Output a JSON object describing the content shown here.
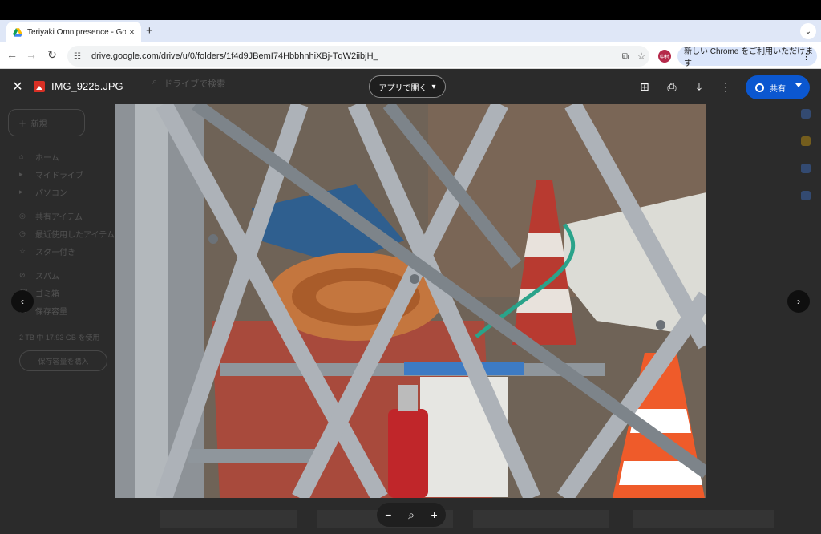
{
  "browser": {
    "tab": {
      "title": "Teriyaki Omnipresence - Goog",
      "close": "×"
    },
    "new_tab": "+",
    "tab_menu": "⌄",
    "nav": {
      "back": "←",
      "forward": "→",
      "reload": "↻"
    },
    "url": "drive.google.com/drive/u/0/folders/1f4d9JBemI74HbbhnhiXBj-TqW2iibjH_",
    "profile_label": "中村",
    "update_banner": "新しい Chrome をご利用いただけます",
    "menu": "⋮"
  },
  "drive_bg": {
    "search_placeholder": "ドライブで検索",
    "new_button": "新規",
    "sidebar": [
      {
        "icon": "⌂",
        "label": "ホーム"
      },
      {
        "icon": "▸",
        "label": "マイドライブ"
      },
      {
        "icon": "▸",
        "label": "パソコン"
      },
      {
        "icon": "◎",
        "label": "共有アイテム"
      },
      {
        "icon": "◷",
        "label": "最近使用したアイテム"
      },
      {
        "icon": "☆",
        "label": "スター付き"
      },
      {
        "icon": "⊘",
        "label": "スパム"
      },
      {
        "icon": "🗑",
        "label": "ゴミ箱"
      },
      {
        "icon": "☁",
        "label": "保存容量"
      }
    ],
    "storage_text": "2 TB 中 17.93 GB を使用",
    "get_storage": "保存容量を購入"
  },
  "viewer": {
    "close": "✕",
    "filename": "IMG_9225.JPG",
    "open_with": "アプリで開く",
    "share": "共有",
    "prev": "‹",
    "next": "›",
    "zoom_out": "−",
    "zoom_reset": "⌕",
    "zoom_in": "+"
  },
  "colors": {
    "viewer_bg": "#2b2b2b",
    "share_blue": "#0b57d0",
    "file_icon_red": "#d93025"
  }
}
